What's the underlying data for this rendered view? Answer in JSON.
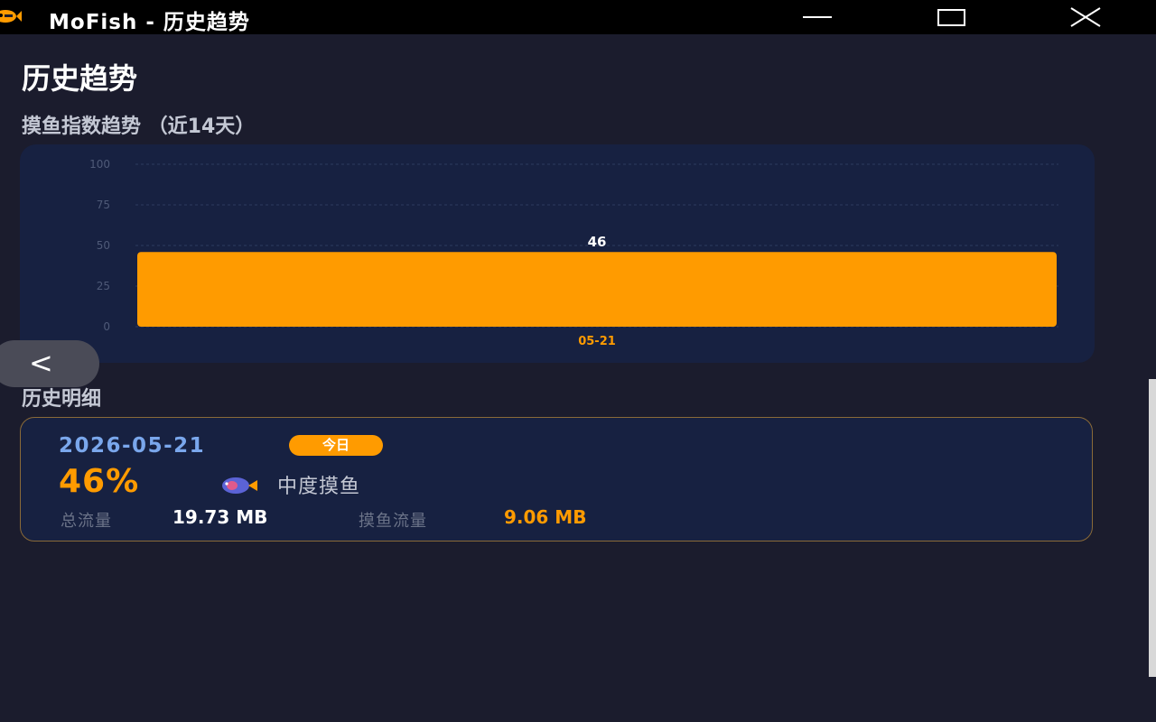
{
  "window": {
    "title": "MoFish - 历史趋势"
  },
  "page": {
    "title": "历史趋势"
  },
  "trend_section": {
    "title": "摸鱼指数趋势 （近14天）"
  },
  "chart_data": {
    "type": "bar",
    "categories": [
      "05-21"
    ],
    "values": [
      46
    ],
    "data_labels": [
      "46"
    ],
    "yticks": [
      "0",
      "25",
      "50",
      "75",
      "100"
    ],
    "ylim": [
      0,
      100
    ],
    "grid": true,
    "bar_color": "#ff9b00",
    "label_color": "#ff9b00"
  },
  "detail_section": {
    "title": "历史明细"
  },
  "records": [
    {
      "date": "2026-05-21",
      "badge": "今日",
      "percent": "46%",
      "level": "中度摸鱼",
      "total_label": "总流量",
      "total_value": "19.73 MB",
      "fish_label": "摸鱼流量",
      "fish_value": "9.06 MB"
    }
  ],
  "colors": {
    "background": "#1b1c2d",
    "card": "#172141",
    "accent": "#ff9b00",
    "date_blue": "#7aa7ec"
  },
  "icons": {
    "app": "fish-icon",
    "minimize": "minimize-icon",
    "maximize": "maximize-icon",
    "close": "close-icon",
    "back": "chevron-left-icon",
    "level": "fish-icon"
  },
  "back_button": {
    "label": "<"
  }
}
